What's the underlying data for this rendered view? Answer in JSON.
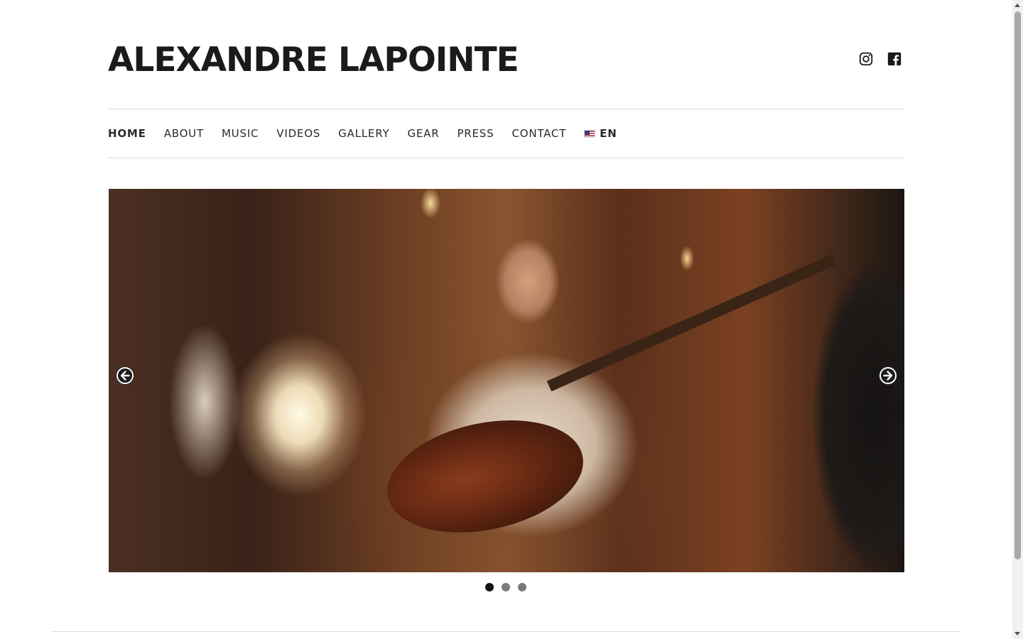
{
  "header": {
    "site_title": "ALEXANDRE LAPOINTE",
    "social_icons": [
      "instagram-icon",
      "facebook-icon"
    ]
  },
  "nav": {
    "items": [
      {
        "label": "HOME",
        "active": true
      },
      {
        "label": "ABOUT",
        "active": false
      },
      {
        "label": "MUSIC",
        "active": false
      },
      {
        "label": "VIDEOS",
        "active": false
      },
      {
        "label": "GALLERY",
        "active": false
      },
      {
        "label": "GEAR",
        "active": false
      },
      {
        "label": "PRESS",
        "active": false
      },
      {
        "label": "CONTACT",
        "active": false
      }
    ],
    "language": {
      "label": "EN",
      "flag_icon": "us-flag-icon"
    }
  },
  "slider": {
    "prev_icon": "arrow-left-icon",
    "next_icon": "arrow-right-icon",
    "slide_count": 3,
    "active_index": 0
  },
  "colors": {
    "text": "#1b1b1b",
    "rule": "#dcdcdc",
    "dot_active": "#111111",
    "dot_inactive": "#7a7a7a"
  }
}
